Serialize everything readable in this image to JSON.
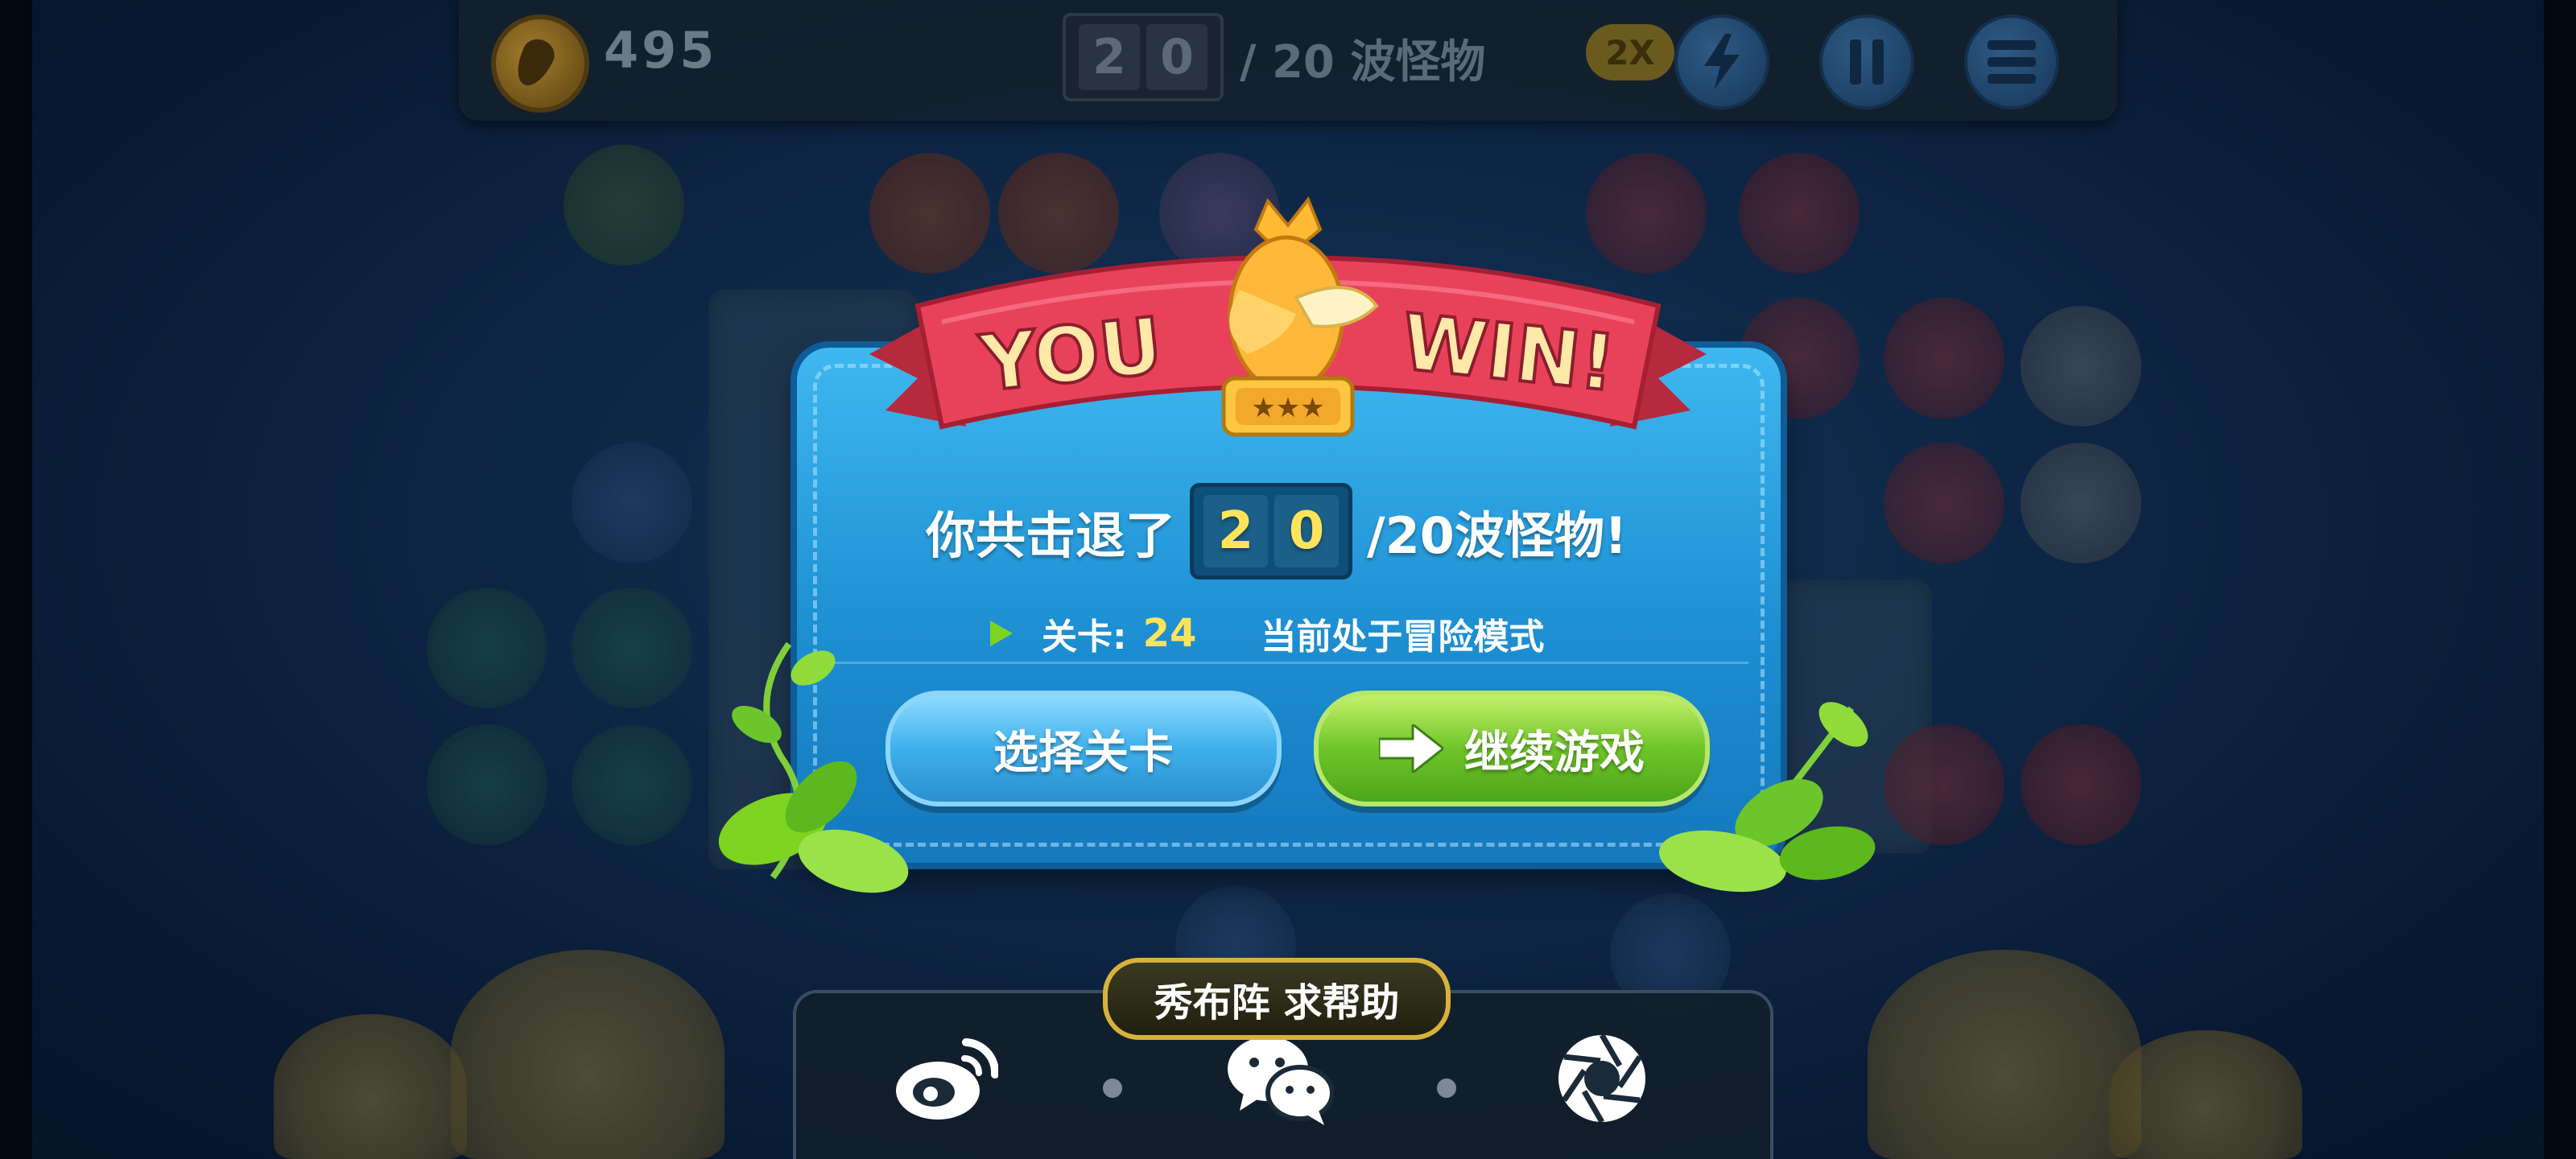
{
  "hud": {
    "gold": "495",
    "wave_digits": [
      "2",
      "0"
    ],
    "wave_total_label": "/ 20 波怪物",
    "speed_label": "2X",
    "icons": [
      "coin-icon",
      "speed-icon",
      "pause-icon",
      "menu-icon"
    ]
  },
  "dialog": {
    "ribbon_left": "YOU",
    "ribbon_right": "WIN!",
    "stars_label": "★★★",
    "summary_prefix": "你共击退了",
    "summary_digits": [
      "2",
      "0"
    ],
    "summary_suffix": "/20波怪物!",
    "level_label": "关卡:",
    "level_number": "24",
    "mode_text": "当前处于冒险模式",
    "select_level_label": "选择关卡",
    "continue_label": "继续游戏"
  },
  "share": {
    "tab_label": "秀布阵 求帮助",
    "icons": [
      "weibo-icon",
      "wechat-icon",
      "camera-aperture-icon"
    ]
  },
  "colors": {
    "dialog_blue": "#1d8fd2",
    "ribbon_red": "#e8425a",
    "ribbon_text": "#ffe9a8",
    "digit_yellow": "#ffe45a",
    "button_blue": "#3fb0ec",
    "button_green": "#6fc52a",
    "share_border": "#d7b23b"
  }
}
